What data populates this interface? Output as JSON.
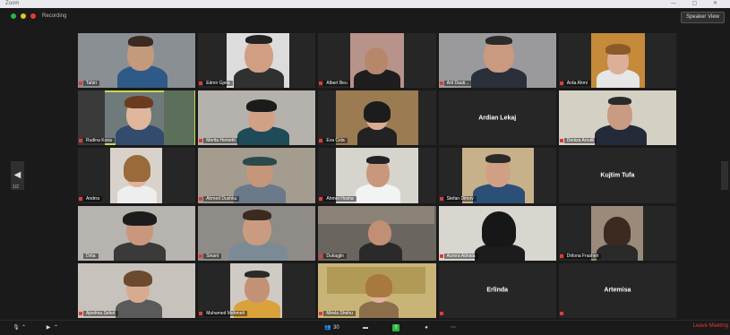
{
  "window": {
    "title": "Zoom",
    "controls": "— ▢ ✕"
  },
  "topbar": {
    "recording_label": "Recording",
    "view_button": "Speaker View"
  },
  "colors": {
    "active_speaker": "#c7d94f",
    "end_red": "#e03a3a",
    "share_green": "#2bb640"
  },
  "pager": {
    "indicator": "1/2"
  },
  "tiles": [
    {
      "name": "Tahiri"
    },
    {
      "name": "Edmir Gjeta"
    },
    {
      "name": "Albert Beu"
    },
    {
      "name": "Arti Dauti..."
    },
    {
      "name": "Arda Ahmi"
    },
    {
      "name": "Rudina Kona"
    },
    {
      "name": "Merita Hemetti"
    },
    {
      "name": "Eva Cela"
    },
    {
      "name": "",
      "center": "Ardian Lekaj"
    },
    {
      "name": "Deniza Arnalli"
    },
    {
      "name": "Andrra"
    },
    {
      "name": "Ahmed Dushku"
    },
    {
      "name": "Ahmet Hoxha"
    },
    {
      "name": "Stefan Dimov"
    },
    {
      "name": "",
      "center": "Kujtim Tufa"
    },
    {
      "name": "Drita"
    },
    {
      "name": "Sinani"
    },
    {
      "name": "Dukagjin"
    },
    {
      "name": "Aurora Adriata"
    },
    {
      "name": "Drilona Frasheri"
    },
    {
      "name": "Ajnelma Seferi"
    },
    {
      "name": "Muhamed Mehmeti"
    },
    {
      "name": "Mirela Shehu"
    },
    {
      "name": "",
      "center": "Erlinda"
    },
    {
      "name": "",
      "center": "Artemisa"
    }
  ],
  "toolbar": {
    "unmute": "",
    "participants_count": "30",
    "end": "Leave Meeting"
  }
}
